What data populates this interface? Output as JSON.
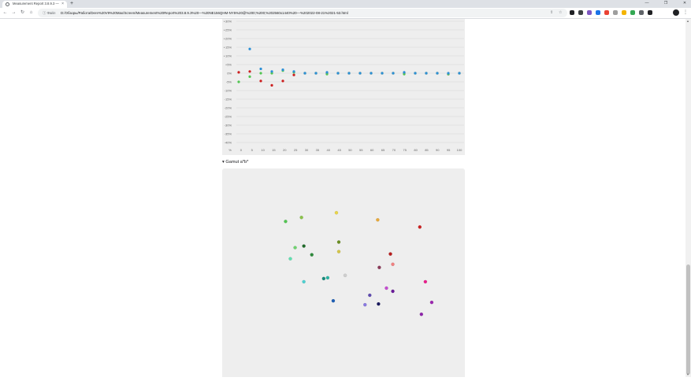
{
  "browser": {
    "tab_title": "Measurement Report 3.8.9.3 — %",
    "new_tab_symbol": "+",
    "tab_close_symbol": "×",
    "window_controls": {
      "minimize": "—",
      "maximize": "❐",
      "close": "✕"
    },
    "nav": {
      "back": "←",
      "forward": "→",
      "reload": "↻",
      "home": "⌂"
    },
    "site_info_label": "ⓘ Файл",
    "url": "D:/Обзоры/Работа/Dere%20V9%20Max/Screen/Measurement%20Report%203.8.9.3%20—%20NE156QHM-NY5%20@%200;%200;%202560x1440%20—%202022-08-21%2021-53.html",
    "extension_colors": [
      "#202124",
      "#3c4043",
      "#7e57c2",
      "#1a73e8",
      "#ea4335",
      "#9e9e9e",
      "#f4b400",
      "#34a853",
      "#5f6368",
      "#202124"
    ]
  },
  "chart_data": [
    {
      "type": "scatter",
      "y_tick_labels": [
        "+30%",
        "+25%",
        "+20%",
        "+15%",
        "+10%",
        "+5%",
        "0%",
        "-5%",
        "-10%",
        "-15%",
        "-20%",
        "-25%",
        "-30%",
        "-35%",
        "-40%"
      ],
      "x_tick_labels": [
        "%",
        "0",
        "5",
        "10",
        "15",
        "20",
        "25",
        "30",
        "35",
        "40",
        "45",
        "50",
        "55",
        "60",
        "65",
        "70",
        "75",
        "80",
        "85",
        "90",
        "95",
        "100"
      ],
      "ylim": [
        -40,
        30
      ],
      "xlim": [
        0,
        100
      ],
      "grid": true,
      "series": [
        {
          "color": "#cc1f1f",
          "points": [
            [
              0,
              0.5
            ],
            [
              5,
              1
            ],
            [
              10,
              -4.5
            ],
            [
              15,
              -7
            ],
            [
              20,
              -4.5
            ],
            [
              25,
              -1
            ],
            [
              30,
              0
            ],
            [
              35,
              0
            ],
            [
              40,
              0
            ],
            [
              45,
              0
            ],
            [
              50,
              0
            ],
            [
              55,
              0
            ],
            [
              60,
              0
            ],
            [
              65,
              0
            ],
            [
              70,
              0
            ],
            [
              75,
              0
            ],
            [
              80,
              0
            ],
            [
              85,
              0
            ],
            [
              90,
              0
            ],
            [
              95,
              -0.5
            ],
            [
              100,
              0
            ]
          ]
        },
        {
          "color": "#52c552",
          "points": [
            [
              0,
              -5
            ],
            [
              5,
              -2
            ],
            [
              10,
              0
            ],
            [
              15,
              0
            ],
            [
              20,
              1.5
            ],
            [
              25,
              0.5
            ],
            [
              30,
              0
            ],
            [
              35,
              0
            ],
            [
              40,
              -0.5
            ],
            [
              45,
              0
            ],
            [
              50,
              0
            ],
            [
              55,
              0
            ],
            [
              60,
              0
            ],
            [
              65,
              0
            ],
            [
              70,
              0
            ],
            [
              75,
              -0.5
            ],
            [
              80,
              0
            ],
            [
              85,
              0
            ],
            [
              90,
              0
            ],
            [
              95,
              -0.5
            ],
            [
              100,
              0
            ]
          ]
        },
        {
          "color": "#2b8fd6",
          "points": [
            [
              5,
              14
            ],
            [
              10,
              2.5
            ],
            [
              15,
              1
            ],
            [
              20,
              2
            ],
            [
              25,
              1
            ],
            [
              30,
              0
            ],
            [
              35,
              0
            ],
            [
              40,
              0.5
            ],
            [
              45,
              0
            ],
            [
              50,
              0
            ],
            [
              55,
              0
            ],
            [
              60,
              0
            ],
            [
              65,
              0
            ],
            [
              70,
              0
            ],
            [
              75,
              0.5
            ],
            [
              80,
              0
            ],
            [
              85,
              0
            ],
            [
              90,
              0
            ],
            [
              95,
              0
            ],
            [
              100,
              0
            ]
          ]
        }
      ]
    },
    {
      "type": "scatter",
      "title": "Gamut a*b*",
      "points": [
        {
          "a": -68,
          "b": 86,
          "color": "#52c552"
        },
        {
          "a": -48,
          "b": 91,
          "color": "#8bc34a"
        },
        {
          "a": -4,
          "b": 97,
          "color": "#e8d44a"
        },
        {
          "a": 48,
          "b": 88,
          "color": "#e8a93a"
        },
        {
          "a": 101,
          "b": 79,
          "color": "#cc1f1f"
        },
        {
          "a": -1,
          "b": 60,
          "color": "#6b8e23"
        },
        {
          "a": -45,
          "b": 55,
          "color": "#1f6b2a"
        },
        {
          "a": -56,
          "b": 53,
          "color": "#6fd36f"
        },
        {
          "a": -1,
          "b": 48,
          "color": "#d4c54a"
        },
        {
          "a": 64,
          "b": 45,
          "color": "#b71c1c"
        },
        {
          "a": -35,
          "b": 44,
          "color": "#2e8b3c"
        },
        {
          "a": -62,
          "b": 39,
          "color": "#5fe0b0"
        },
        {
          "a": 67,
          "b": 32,
          "color": "#f08080"
        },
        {
          "a": 50,
          "b": 28,
          "color": "#8b3a5a"
        },
        {
          "a": 7,
          "b": 18,
          "color": "#cfcfcf"
        },
        {
          "a": -20,
          "b": 14,
          "color": "#1a8a7a"
        },
        {
          "a": -15,
          "b": 15,
          "color": "#2bb5a5"
        },
        {
          "a": -45,
          "b": 10,
          "color": "#4dd0d0"
        },
        {
          "a": 108,
          "b": 10,
          "color": "#e91e8c"
        },
        {
          "a": 59,
          "b": 2,
          "color": "#c44dd1"
        },
        {
          "a": 67,
          "b": -2,
          "color": "#6a1b9a"
        },
        {
          "a": 38,
          "b": -7,
          "color": "#5e4ab0"
        },
        {
          "a": -8,
          "b": -14,
          "color": "#1e5fb5"
        },
        {
          "a": 116,
          "b": -16,
          "color": "#9c27b0"
        },
        {
          "a": 32,
          "b": -19,
          "color": "#8a7ae0"
        },
        {
          "a": 49,
          "b": -18,
          "color": "#1a1a5e"
        },
        {
          "a": 103,
          "b": -31,
          "color": "#8e24aa"
        }
      ]
    }
  ],
  "sections": {
    "gamut_toggle_label": "▾ Gamut a*b*"
  }
}
